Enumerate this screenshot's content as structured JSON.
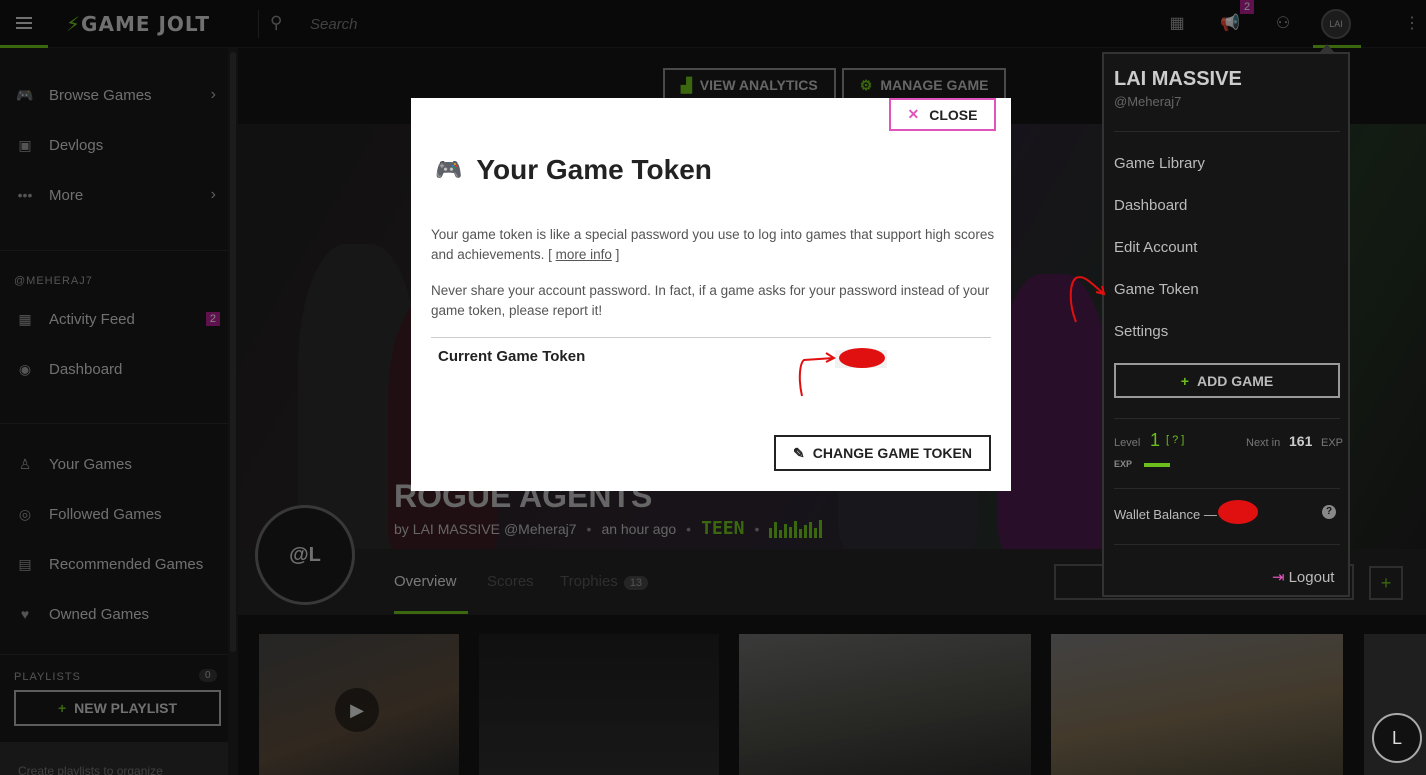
{
  "topbar": {
    "logo_text": "GAME JOLT",
    "search_placeholder": "Search",
    "notifications_count": "2",
    "avatar_initials": "LAI"
  },
  "sidebar": {
    "main_items": [
      {
        "label": "Browse Games",
        "icon": "gamepad-icon"
      },
      {
        "label": "Devlogs",
        "icon": "devlog-icon"
      },
      {
        "label": "More",
        "icon": "more-dots-icon"
      }
    ],
    "user_heading": "@MEHERAJ7",
    "user_items": [
      {
        "label": "Activity Feed",
        "icon": "feed-icon",
        "badge": "2"
      },
      {
        "label": "Dashboard",
        "icon": "avatar-icon"
      }
    ],
    "library_items": [
      {
        "label": "Your Games",
        "icon": "user-games-icon"
      },
      {
        "label": "Followed Games",
        "icon": "eye-icon"
      },
      {
        "label": "Recommended Games",
        "icon": "recommended-icon"
      },
      {
        "label": "Owned Games",
        "icon": "heart-icon"
      }
    ],
    "playlists_heading": "PLAYLISTS",
    "playlists_count": "0",
    "new_playlist_label": "NEW PLAYLIST",
    "create_hint": "Create playlists to organize"
  },
  "game_page": {
    "view_analytics_label": "VIEW ANALYTICS",
    "manage_game_label": "MANAGE GAME",
    "title": "ROGUE AGENTS",
    "by": "by",
    "author": "LAI MASSIVE",
    "author_handle": "@Meheraj7",
    "posted": "an hour ago",
    "rating": "TEEN",
    "tabs": {
      "overview": "Overview",
      "scores": "Scores",
      "trophies": "Trophies",
      "trophies_count": "13"
    },
    "avatar_text": "@L"
  },
  "modal": {
    "close_label": "CLOSE",
    "title": "Your Game Token",
    "para1_text": "Your game token is like a special password you use to log into games that support high scores and achievements. [",
    "para1_link": "more info",
    "para1_end": "]",
    "para2": "Never share your account password. In fact, if a game asks for your password instead of your game token, please report it!",
    "token_label": "Current Game Token",
    "change_label": "CHANGE GAME TOKEN"
  },
  "user_menu": {
    "name": "LAI MASSIVE",
    "handle": "@Meheraj7",
    "items": [
      "Game Library",
      "Dashboard",
      "Edit Account",
      "Game Token",
      "Settings"
    ],
    "add_game_label": "ADD GAME",
    "level_label": "Level",
    "level": "1",
    "level_help": "[ ? ]",
    "next_in_label": "Next in",
    "exp_needed": "161",
    "exp_label": "EXP",
    "exp_fraction": 0.14,
    "exp_badge": "EXP",
    "wallet_label": "Wallet Balance —",
    "help": "?",
    "logout_label": "Logout"
  },
  "chat": {
    "initial": "L"
  },
  "colors": {
    "accent": "#6cbe1c",
    "pink": "#e055bd",
    "badge": "#ac1f8d",
    "annotation": "#e01010"
  }
}
